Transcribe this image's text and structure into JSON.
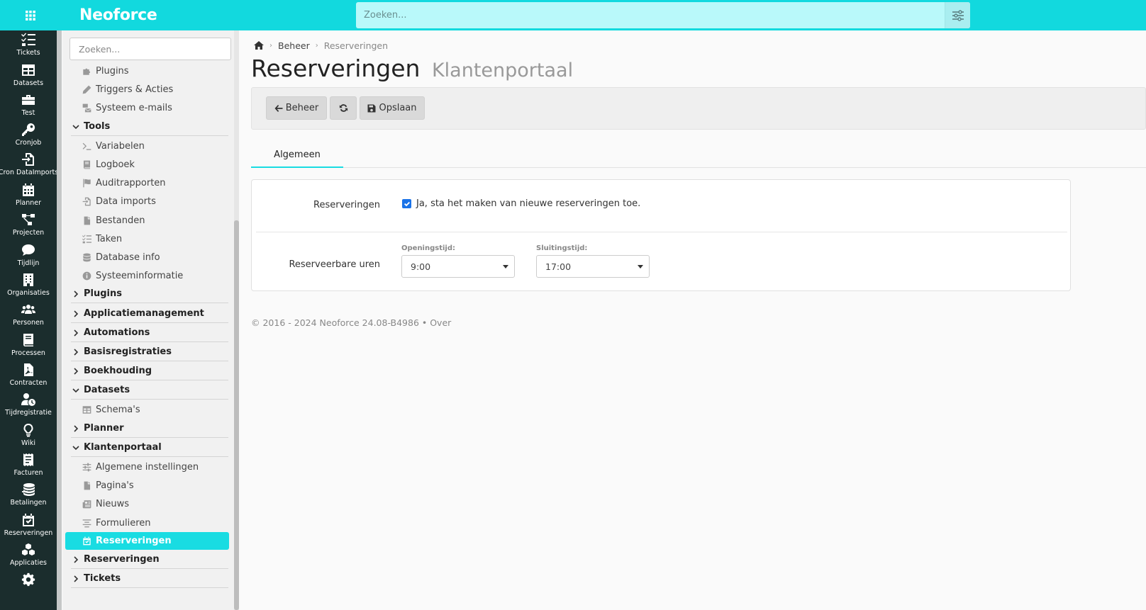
{
  "topbar": {
    "logo": "Neoforce",
    "search_placeholder": "Zoeken..."
  },
  "rail": {
    "items": [
      {
        "label": "Tickets",
        "icon": "tasks-icon"
      },
      {
        "label": "Datasets",
        "icon": "table-icon"
      },
      {
        "label": "Test",
        "icon": "toolbox-icon"
      },
      {
        "label": "Cronjob",
        "icon": "key-icon"
      },
      {
        "label": "Cron DataImports",
        "icon": "file-import-icon"
      },
      {
        "label": "Planner",
        "icon": "calendar-icon"
      },
      {
        "label": "Projecten",
        "icon": "project-diagram-icon"
      },
      {
        "label": "Tijdlijn",
        "icon": "comment-icon"
      },
      {
        "label": "Organisaties",
        "icon": "building-icon"
      },
      {
        "label": "Personen",
        "icon": "users-icon"
      },
      {
        "label": "Processen",
        "icon": "book-icon"
      },
      {
        "label": "Contracten",
        "icon": "file-pdf-icon"
      },
      {
        "label": "Tijdregistratie",
        "icon": "user-clock-icon"
      },
      {
        "label": "Wiki",
        "icon": "lightbulb-icon"
      },
      {
        "label": "Facturen",
        "icon": "receipt-icon"
      },
      {
        "label": "Betalingen",
        "icon": "coins-icon"
      },
      {
        "label": "Reserveringen",
        "icon": "calendar-check-icon"
      },
      {
        "label": "Applicaties",
        "icon": "cubes-icon"
      }
    ]
  },
  "tree": {
    "search_placeholder": "Zoeken...",
    "items": [
      {
        "label": "Plugins",
        "type": "child",
        "icon": "puzzle-icon"
      },
      {
        "label": "Triggers & Acties",
        "type": "child",
        "icon": "pencil-icon"
      },
      {
        "label": "Systeem e-mails",
        "type": "child",
        "icon": "mail-bulk-icon"
      },
      {
        "label": "Tools",
        "type": "section",
        "chev": "v"
      },
      {
        "label": "Variabelen",
        "type": "child",
        "icon": "terminal-icon"
      },
      {
        "label": "Logboek",
        "type": "child",
        "icon": "book-icon"
      },
      {
        "label": "Auditrapporten",
        "type": "child",
        "icon": "flag-icon"
      },
      {
        "label": "Data imports",
        "type": "child",
        "icon": "file-import-icon"
      },
      {
        "label": "Bestanden",
        "type": "child",
        "icon": "file-icon"
      },
      {
        "label": "Taken",
        "type": "child",
        "icon": "tasks-icon"
      },
      {
        "label": "Database info",
        "type": "child",
        "icon": "database-icon"
      },
      {
        "label": "Systeeminformatie",
        "type": "child",
        "icon": "info-circle-icon"
      },
      {
        "label": "Plugins",
        "type": "section",
        "chev": ">"
      },
      {
        "label": "Applicatiemanagement",
        "type": "section",
        "chev": ">"
      },
      {
        "label": "Automations",
        "type": "section",
        "chev": ">"
      },
      {
        "label": "Basisregistraties",
        "type": "section",
        "chev": ">"
      },
      {
        "label": "Boekhouding",
        "type": "section",
        "chev": ">"
      },
      {
        "label": "Datasets",
        "type": "section",
        "chev": "v"
      },
      {
        "label": "Schema's",
        "type": "child",
        "icon": "table-icon"
      },
      {
        "label": "Planner",
        "type": "section",
        "chev": ">"
      },
      {
        "label": "Klantenportaal",
        "type": "section",
        "chev": "v"
      },
      {
        "label": "Algemene instellingen",
        "type": "child",
        "icon": "sliders-icon"
      },
      {
        "label": "Pagina's",
        "type": "child",
        "icon": "file-icon"
      },
      {
        "label": "Nieuws",
        "type": "child",
        "icon": "newspaper-icon"
      },
      {
        "label": "Formulieren",
        "type": "child",
        "icon": "align-center-icon"
      },
      {
        "label": "Reserveringen",
        "type": "active",
        "icon": "calendar-check-icon"
      },
      {
        "label": "Reserveringen",
        "type": "section",
        "chev": ">"
      },
      {
        "label": "Tickets",
        "type": "section",
        "chev": ">"
      }
    ]
  },
  "breadcrumb": {
    "items": [
      "Beheer",
      "Reserveringen"
    ]
  },
  "page": {
    "title": "Reserveringen",
    "subtitle": "Klantenportaal"
  },
  "toolbar": {
    "back_label": "Beheer",
    "save_label": "Opslaan"
  },
  "tabs": [
    {
      "label": "Algemeen"
    }
  ],
  "form": {
    "reservations_label": "Reserveringen",
    "reservations_checkbox_label": "Ja, sta het maken van nieuwe reserveringen toe.",
    "reservations_checked": true,
    "hours_label": "Reserveerbare uren",
    "opening_label": "Openingstijd:",
    "opening_value": "9:00",
    "closing_label": "Sluitingstijd:",
    "closing_value": "17:00"
  },
  "footer": {
    "text": "© 2016 - 2024 Neoforce 24.08-B4986 • Over"
  },
  "colors": {
    "accent": "#12d9de",
    "rail": "#1b2d2d",
    "checkbox": "#1a73e8"
  }
}
